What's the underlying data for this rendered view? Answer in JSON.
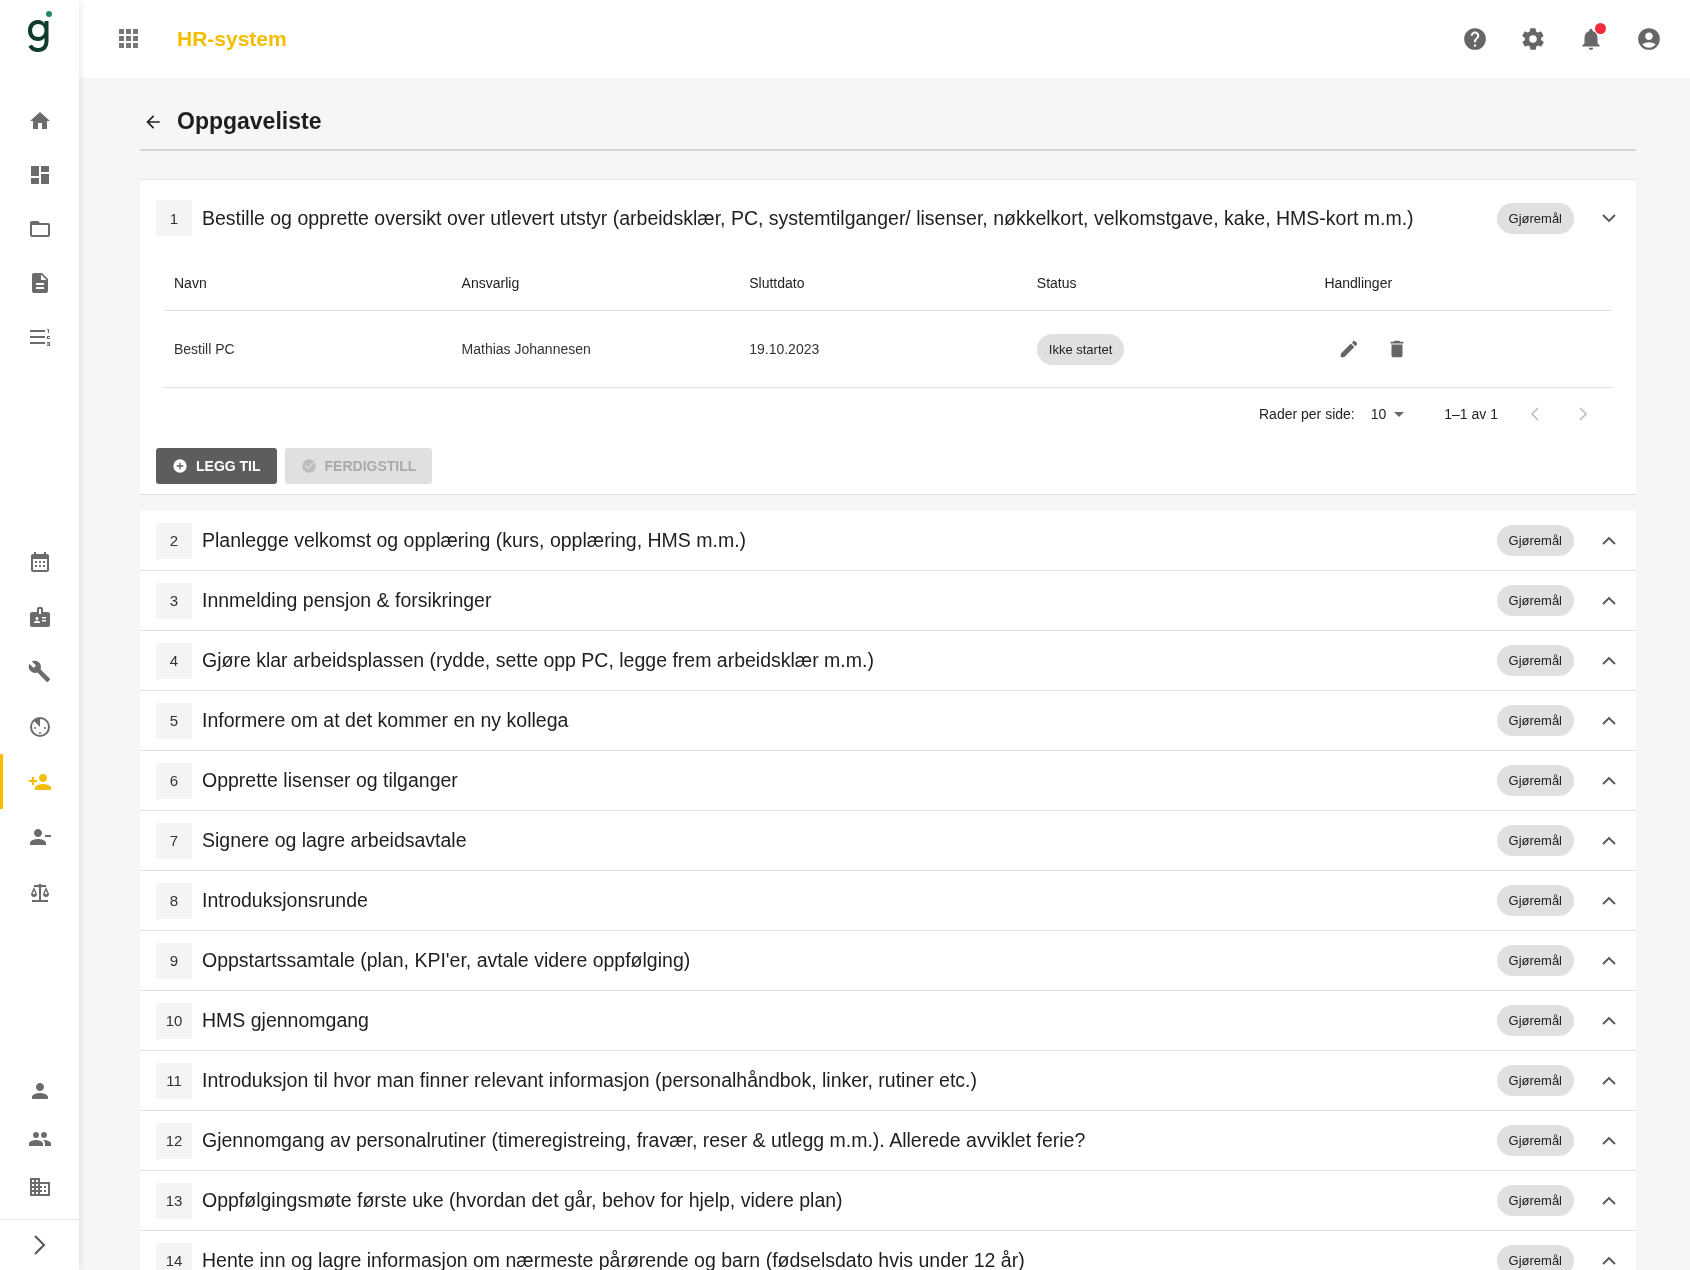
{
  "app": {
    "title": "HR-system"
  },
  "sidebar": {
    "top": [
      {
        "kind": "home",
        "selected": false
      },
      {
        "kind": "dashboard",
        "selected": false
      },
      {
        "kind": "folder",
        "selected": false
      },
      {
        "kind": "document",
        "selected": false
      },
      {
        "kind": "numbered-list",
        "selected": false
      }
    ],
    "middle": [
      {
        "kind": "calendar",
        "selected": false
      },
      {
        "kind": "badge",
        "selected": false
      },
      {
        "kind": "tools",
        "selected": false
      },
      {
        "kind": "timer",
        "selected": false
      },
      {
        "kind": "person-add",
        "selected": true
      },
      {
        "kind": "person-remove",
        "selected": false
      },
      {
        "kind": "scale",
        "selected": false
      }
    ],
    "bottom": [
      {
        "kind": "person",
        "selected": false
      },
      {
        "kind": "people",
        "selected": false
      },
      {
        "kind": "building",
        "selected": false
      }
    ]
  },
  "header": {
    "has_notification": true
  },
  "page": {
    "title": "Oppgaveliste"
  },
  "tasks": [
    {
      "number": "1",
      "title": "Bestille og opprette oversikt over utlevert utstyr (arbeidsklær, PC, systemtilganger/ lisenser, nøkkelkort, velkomstgave, kake, HMS-kort m.m.)",
      "tag": "Gjøremål",
      "expanded": true,
      "table": {
        "columns": [
          "Navn",
          "Ansvarlig",
          "Sluttdato",
          "Status",
          "Handlinger"
        ],
        "rows": [
          {
            "name": "Bestill PC",
            "responsible": "Mathias Johannesen",
            "due": "19.10.2023",
            "status": "Ikke startet"
          }
        ],
        "rows_per_page_label": "Rader per side:",
        "rows_per_page": "10",
        "range": "1–1 av 1"
      },
      "buttons": [
        {
          "label": "LEGG TIL",
          "disabled": false,
          "kind": "add"
        },
        {
          "label": "FERDIGSTILL",
          "disabled": true,
          "kind": "complete"
        }
      ]
    },
    {
      "number": "2",
      "title": "Planlegge velkomst og opplæring (kurs, opplæring, HMS m.m.)",
      "tag": "Gjøremål",
      "expanded": false
    },
    {
      "number": "3",
      "title": "Innmelding pensjon & forsikringer",
      "tag": "Gjøremål",
      "expanded": false
    },
    {
      "number": "4",
      "title": "Gjøre klar arbeidsplassen (rydde, sette opp PC, legge frem arbeidsklær m.m.)",
      "tag": "Gjøremål",
      "expanded": false
    },
    {
      "number": "5",
      "title": "Informere om at det kommer en ny kollega",
      "tag": "Gjøremål",
      "expanded": false
    },
    {
      "number": "6",
      "title": "Opprette lisenser og tilganger",
      "tag": "Gjøremål",
      "expanded": false
    },
    {
      "number": "7",
      "title": "Signere og lagre arbeidsavtale",
      "tag": "Gjøremål",
      "expanded": false
    },
    {
      "number": "8",
      "title": "Introduksjonsrunde",
      "tag": "Gjøremål",
      "expanded": false
    },
    {
      "number": "9",
      "title": "Oppstartssamtale (plan, KPI'er, avtale videre oppfølging)",
      "tag": "Gjøremål",
      "expanded": false
    },
    {
      "number": "10",
      "title": "HMS gjennomgang",
      "tag": "Gjøremål",
      "expanded": false
    },
    {
      "number": "11",
      "title": "Introduksjon til hvor man finner relevant informasjon (personalhåndbok, linker, rutiner etc.)",
      "tag": "Gjøremål",
      "expanded": false
    },
    {
      "number": "12",
      "title": "Gjennomgang av personalrutiner (timeregistreing, fravær, reser & utlegg m.m.). Allerede avviklet ferie?",
      "tag": "Gjøremål",
      "expanded": false
    },
    {
      "number": "13",
      "title": "Oppfølgingsmøte første uke (hvordan det går, behov for hjelp, videre plan)",
      "tag": "Gjøremål",
      "expanded": false
    },
    {
      "number": "14",
      "title": "Hente inn og lagre informasjon om nærmeste pårørende og barn (fødselsdato hvis under 12 år)",
      "tag": "Gjøremål",
      "expanded": false
    }
  ]
}
